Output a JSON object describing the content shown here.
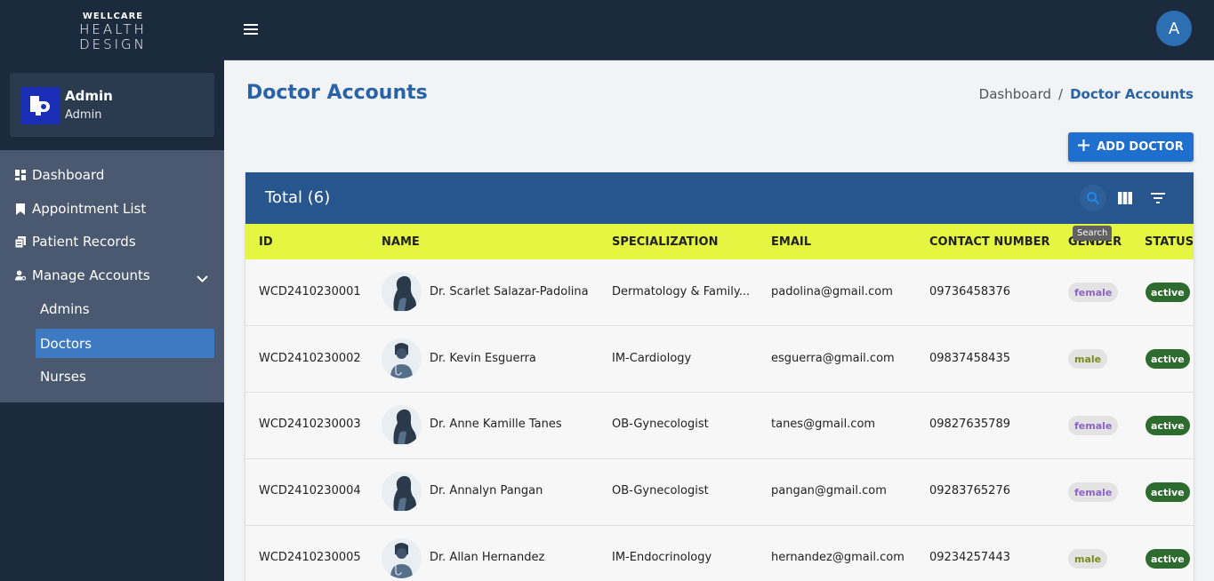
{
  "brand": {
    "line1": "WELLCARE",
    "line2": "HEALTH",
    "line3": "DESIGN"
  },
  "user": {
    "name": "Admin",
    "role": "Admin"
  },
  "sidebar": {
    "items": [
      {
        "label": "Dashboard",
        "icon": "dashboard-icon"
      },
      {
        "label": "Appointment List",
        "icon": "bookmark-icon"
      },
      {
        "label": "Patient Records",
        "icon": "records-icon"
      },
      {
        "label": "Manage Accounts",
        "icon": "manage-accounts-icon"
      }
    ],
    "subitems": [
      {
        "label": "Admins"
      },
      {
        "label": "Doctors",
        "active": true
      },
      {
        "label": "Nurses"
      }
    ]
  },
  "topbar": {
    "avatar_letter": "A"
  },
  "page": {
    "title": "Doctor Accounts",
    "breadcrumb": {
      "home": "Dashboard",
      "separator": "/",
      "current": "Doctor Accounts"
    },
    "add_button": "ADD DOCTOR"
  },
  "table": {
    "title": "Total (6)",
    "tooltip": "Search",
    "columns": [
      "ID",
      "NAME",
      "SPECIALIZATION",
      "EMAIL",
      "CONTACT NUMBER",
      "GENDER",
      "STATUS"
    ],
    "rows": [
      {
        "id": "WCD2410230001",
        "name": "Dr. Scarlet Salazar-Padolina",
        "specialization": "Dermatology & Family...",
        "email": "padolina@gmail.com",
        "contact": "09736458376",
        "gender": "female",
        "status": "active"
      },
      {
        "id": "WCD2410230002",
        "name": "Dr. Kevin Esguerra",
        "specialization": "IM-Cardiology",
        "email": "esguerra@gmail.com",
        "contact": "09837458435",
        "gender": "male",
        "status": "active"
      },
      {
        "id": "WCD2410230003",
        "name": "Dr. Anne Kamille Tanes",
        "specialization": "OB-Gynecologist",
        "email": "tanes@gmail.com",
        "contact": "09827635789",
        "gender": "female",
        "status": "active"
      },
      {
        "id": "WCD2410230004",
        "name": "Dr. Annalyn Pangan",
        "specialization": "OB-Gynecologist",
        "email": "pangan@gmail.com",
        "contact": "09283765276",
        "gender": "female",
        "status": "active"
      },
      {
        "id": "WCD2410230005",
        "name": "Dr. Allan Hernandez",
        "specialization": "IM-Endocrinology",
        "email": "hernandez@gmail.com",
        "contact": "09234257443",
        "gender": "male",
        "status": "active"
      }
    ]
  },
  "colors": {
    "sidebar": "#1b2a3d",
    "accent": "#2a63a5",
    "header_row": "#e4f542",
    "status_active": "#2e6b2e"
  }
}
